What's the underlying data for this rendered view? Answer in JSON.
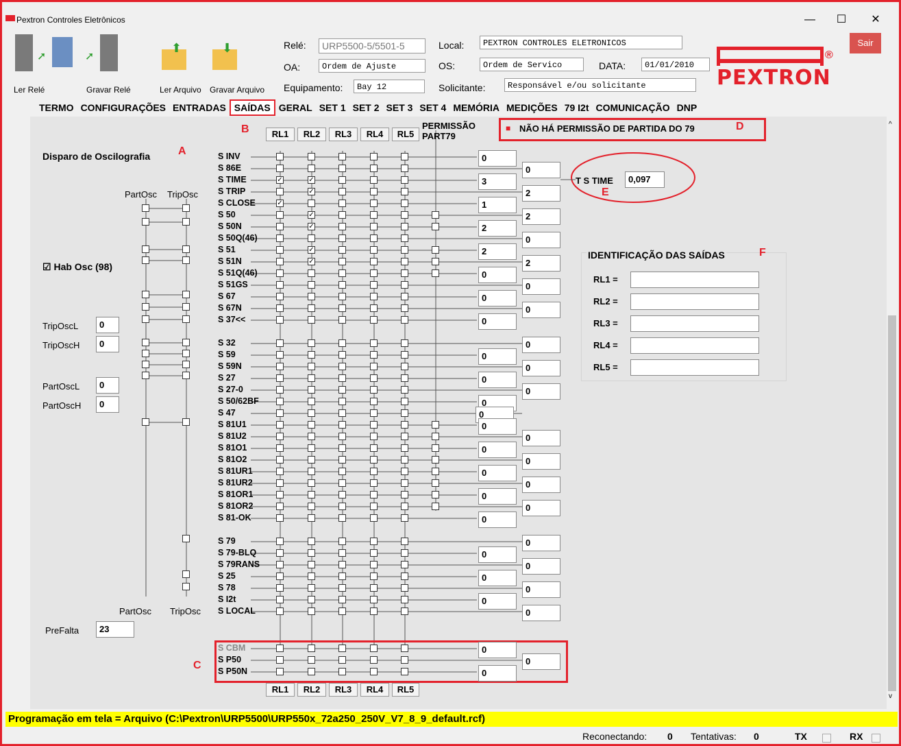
{
  "window": {
    "title": "Pextron Controles Eletrônicos",
    "minimize": "—",
    "maximize": "☐",
    "close": "✕",
    "exit_button": "Sair"
  },
  "toolbar": {
    "read_relay": "Ler Relé",
    "write_relay": "Gravar Relé",
    "read_file": "Ler Arquivo",
    "write_file": "Gravar Arquivo"
  },
  "header": {
    "rele_label": "Relé:",
    "rele_value": "URP5500-5/5501-5",
    "oa_label": "OA:",
    "oa_value": "Ordem de Ajuste",
    "equip_label": "Equipamento:",
    "equip_value": "Bay 12",
    "local_label": "Local:",
    "local_value": "PEXTRON CONTROLES ELETRONICOS",
    "os_label": "OS:",
    "os_value": "Ordem de Servico",
    "data_label": "DATA:",
    "data_value": "01/01/2010",
    "solic_label": "Solicitante:",
    "solic_value": "Responsável e/ou solicitante",
    "logo_text": "PEXTRON",
    "logo_reg": "®"
  },
  "tabs": [
    "TERMO",
    "CONFIGURAÇÕES",
    "ENTRADAS",
    "SAÍDAS",
    "GERAL",
    "SET 1",
    "SET 2",
    "SET 3",
    "SET 4",
    "MEMÓRIA",
    "MEDIÇÕES",
    "79 I2t",
    "COMUNICAÇÃO",
    "DNP"
  ],
  "active_tab": "SAÍDAS",
  "markers": {
    "a": "A",
    "b": "B",
    "c": "C",
    "d": "D",
    "e": "E",
    "f": "F"
  },
  "osc": {
    "title": "Disparo de Oscilografia",
    "part_osc": "PartOsc",
    "trip_osc": "TripOsc",
    "hab_osc": "Hab Osc (98)",
    "hab_checked": "☑",
    "triposcl_label": "TripOscL",
    "triposcl": "0",
    "triposch_label": "TripOscH",
    "triposch": "0",
    "partoscl_label": "PartOscL",
    "partoscl": "0",
    "partosch_label": "PartOscH",
    "partosch": "0",
    "prefalta_label": "PreFalta",
    "prefalta": "23"
  },
  "relays": [
    "RL1",
    "RL2",
    "RL3",
    "RL4",
    "RL5"
  ],
  "permissao": {
    "line1": "PERMISSÃO",
    "line2": "PART79"
  },
  "no_permission": "NÃO HÁ PERMISSÃO DE PARTIDA DO 79",
  "no_permission_icon": "■",
  "tstime": {
    "label": "T S TIME",
    "value": "0,097"
  },
  "ident": {
    "title": "IDENTIFICAÇÃO DAS SAÍDAS",
    "labels": [
      "RL1 =",
      "RL2 =",
      "RL3 =",
      "RL4 =",
      "RL5 ="
    ],
    "values": [
      "",
      "",
      "",
      "",
      ""
    ]
  },
  "signals": [
    {
      "name": "S INV",
      "checks": [
        0,
        0,
        0,
        0,
        0
      ]
    },
    {
      "name": "S 86E",
      "checks": [
        0,
        0,
        0,
        0,
        0
      ]
    },
    {
      "name": "S TIME",
      "checks": [
        1,
        1,
        0,
        0,
        0
      ]
    },
    {
      "name": "S TRIP",
      "checks": [
        0,
        1,
        0,
        0,
        0
      ]
    },
    {
      "name": "S CLOSE",
      "checks": [
        1,
        0,
        0,
        0,
        0
      ]
    },
    {
      "name": "S 50",
      "checks": [
        0,
        1,
        0,
        0,
        0
      ]
    },
    {
      "name": "S 50N",
      "checks": [
        0,
        1,
        0,
        0,
        0
      ]
    },
    {
      "name": "S 50Q(46)",
      "checks": [
        0,
        0,
        0,
        0,
        0
      ]
    },
    {
      "name": "S 51",
      "checks": [
        0,
        1,
        0,
        0,
        0
      ]
    },
    {
      "name": "S 51N",
      "checks": [
        0,
        1,
        0,
        0,
        0
      ]
    },
    {
      "name": "S 51Q(46)",
      "checks": [
        0,
        0,
        0,
        0,
        0
      ]
    },
    {
      "name": "S 51GS",
      "checks": [
        0,
        0,
        0,
        0,
        0
      ]
    },
    {
      "name": "S 67",
      "checks": [
        0,
        0,
        0,
        0,
        0
      ]
    },
    {
      "name": "S 67N",
      "checks": [
        0,
        0,
        0,
        0,
        0
      ]
    },
    {
      "name": "S 37<<",
      "checks": [
        0,
        0,
        0,
        0,
        0
      ]
    },
    {
      "name": "S 32",
      "checks": [
        0,
        0,
        0,
        0,
        0
      ]
    },
    {
      "name": "S 59",
      "checks": [
        0,
        0,
        0,
        0,
        0
      ]
    },
    {
      "name": "S 59N",
      "checks": [
        0,
        0,
        0,
        0,
        0
      ]
    },
    {
      "name": "S 27",
      "checks": [
        0,
        0,
        0,
        0,
        0
      ]
    },
    {
      "name": "S 27-0",
      "checks": [
        0,
        0,
        0,
        0,
        0
      ]
    },
    {
      "name": "S 50/62BF",
      "checks": [
        0,
        0,
        0,
        0,
        0
      ]
    },
    {
      "name": "S 47",
      "checks": [
        0,
        0,
        0,
        0,
        0
      ]
    },
    {
      "name": "S 81U1",
      "checks": [
        0,
        0,
        0,
        0,
        0
      ]
    },
    {
      "name": "S 81U2",
      "checks": [
        0,
        0,
        0,
        0,
        0
      ]
    },
    {
      "name": "S 81O1",
      "checks": [
        0,
        0,
        0,
        0,
        0
      ]
    },
    {
      "name": "S 81O2",
      "checks": [
        0,
        0,
        0,
        0,
        0
      ]
    },
    {
      "name": "S 81UR1",
      "checks": [
        0,
        0,
        0,
        0,
        0
      ]
    },
    {
      "name": "S 81UR2",
      "checks": [
        0,
        0,
        0,
        0,
        0
      ]
    },
    {
      "name": "S 81OR1",
      "checks": [
        0,
        0,
        0,
        0,
        0
      ]
    },
    {
      "name": "S 81OR2",
      "checks": [
        0,
        0,
        0,
        0,
        0
      ]
    },
    {
      "name": "S 81-OK",
      "checks": [
        0,
        0,
        0,
        0,
        0
      ]
    },
    {
      "name": "S 79",
      "checks": [
        0,
        0,
        0,
        0,
        0
      ]
    },
    {
      "name": "S 79-BLQ",
      "checks": [
        0,
        0,
        0,
        0,
        0
      ]
    },
    {
      "name": "S 79RANS",
      "checks": [
        0,
        0,
        0,
        0,
        0
      ]
    },
    {
      "name": "S 25",
      "checks": [
        0,
        0,
        0,
        0,
        0
      ]
    },
    {
      "name": "S 78",
      "checks": [
        0,
        0,
        0,
        0,
        0
      ]
    },
    {
      "name": "S I2t",
      "checks": [
        0,
        0,
        0,
        0,
        0
      ]
    },
    {
      "name": "S LOCAL",
      "checks": [
        0,
        0,
        0,
        0,
        0
      ]
    },
    {
      "name": "S CBM",
      "checks": [
        0,
        0,
        0,
        0,
        0
      ]
    },
    {
      "name": "S P50",
      "checks": [
        0,
        0,
        0,
        0,
        0
      ]
    },
    {
      "name": "S P50N",
      "checks": [
        0,
        0,
        0,
        0,
        0
      ]
    }
  ],
  "time_values": [
    "0",
    "0",
    "3",
    "2",
    "1",
    "2",
    "2",
    "0",
    "2",
    "2",
    "0",
    "0",
    "0",
    "0",
    "0",
    "0",
    "0",
    "0",
    "0",
    "0",
    "0",
    "0",
    "0",
    "0",
    "0",
    "0",
    "0",
    "0",
    "0",
    "0",
    "0",
    "0",
    "0",
    "0",
    "0",
    "0",
    "0",
    "0",
    "0",
    "0",
    "0"
  ],
  "status_bar": "Programação em tela = Arquivo (C:\\Pextron\\URP5500\\URP550x_72a250_250V_V7_8_9_default.rcf)",
  "bottom": {
    "reconnect_label": "Reconectando:",
    "reconnect": "0",
    "tries_label": "Tentativas:",
    "tries": "0",
    "tx": "TX",
    "rx": "RX"
  }
}
